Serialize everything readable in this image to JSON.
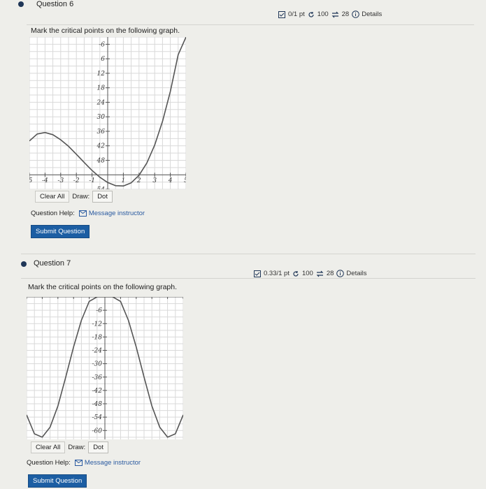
{
  "questions": [
    {
      "title": "Question 6",
      "score": "0/1 pt",
      "attempts": "100",
      "retries": "28",
      "details": "Details",
      "prompt": "Mark the critical points on the following graph.",
      "clear_all": "Clear All",
      "draw_label": "Draw:",
      "dot": "Dot",
      "help_label": "Question Help:",
      "message_instructor": "Message instructor",
      "submit": "Submit Question",
      "graph": {
        "x_ticks": [
          "-5",
          "-4",
          "-3",
          "-2",
          "-1",
          "1",
          "2",
          "3",
          "4",
          "5"
        ],
        "y_ticks": [
          "54",
          "48",
          "42",
          "36",
          "30",
          "24",
          "18",
          "12",
          "6",
          "-6"
        ]
      }
    },
    {
      "title": "Question 7",
      "score": "0.33/1 pt",
      "attempts": "100",
      "retries": "28",
      "details": "Details",
      "prompt": "Mark the critical points on the following graph.",
      "clear_all": "Clear All",
      "draw_label": "Draw:",
      "dot": "Dot",
      "help_label": "Question Help:",
      "message_instructor": "Message instructor",
      "submit": "Submit Question",
      "graph": {
        "x_ticks": [
          "-5",
          "-4",
          "-3",
          "-2",
          "-1",
          "1",
          "2",
          "3",
          "4",
          "5"
        ],
        "y_ticks": [
          "-6",
          "-12",
          "-18",
          "-24",
          "-30",
          "-36",
          "-42",
          "-48",
          "-54",
          "-60"
        ]
      }
    }
  ],
  "chart_data": [
    {
      "type": "line",
      "title": "",
      "xlim": [
        -5,
        5
      ],
      "ylim": [
        -6,
        57
      ],
      "x_ticks": [
        -5,
        -4,
        -3,
        -2,
        -1,
        1,
        2,
        3,
        4,
        5
      ],
      "y_ticks": [
        -6,
        6,
        12,
        18,
        24,
        30,
        36,
        42,
        48,
        54
      ],
      "grid": true,
      "series": [
        {
          "x": [
            -5,
            -4.5,
            -4,
            -3.5,
            -3,
            -2.5,
            -2,
            -1.5,
            -1,
            -0.5,
            0,
            0.5,
            1,
            1.5,
            2,
            2.5,
            3,
            3.5,
            4,
            4.5,
            5
          ],
          "y": [
            14,
            16.9,
            17.5,
            16.6,
            14.5,
            11.8,
            8.5,
            5.1,
            1.8,
            -1,
            -3.2,
            -4.5,
            -4.6,
            -3.3,
            -0.2,
            4.9,
            12.3,
            22.1,
            34.5,
            49.7,
            57
          ]
        }
      ]
    },
    {
      "type": "line",
      "title": "",
      "xlim": [
        -5,
        5
      ],
      "ylim": [
        -64,
        0
      ],
      "x_ticks": [
        -5,
        -4,
        -3,
        -2,
        -1,
        1,
        2,
        3,
        4,
        5
      ],
      "y_ticks": [
        -6,
        -12,
        -18,
        -24,
        -30,
        -36,
        -42,
        -48,
        -54,
        -60
      ],
      "grid": true,
      "series": [
        {
          "x": [
            -5,
            -4.5,
            -4,
            -3.5,
            -3,
            -2.5,
            -2,
            -1.5,
            -1,
            -0.5,
            0,
            0.5,
            1,
            1.5,
            2,
            2.5,
            3,
            3.5,
            4,
            4.5,
            5
          ],
          "y": [
            -53,
            -61.5,
            -63,
            -58.5,
            -49,
            -36,
            -22.5,
            -10.5,
            -2,
            0,
            0,
            0,
            -2,
            -10.5,
            -22.5,
            -36,
            -49,
            -58.5,
            -63,
            -61.5,
            -53
          ]
        }
      ]
    }
  ]
}
